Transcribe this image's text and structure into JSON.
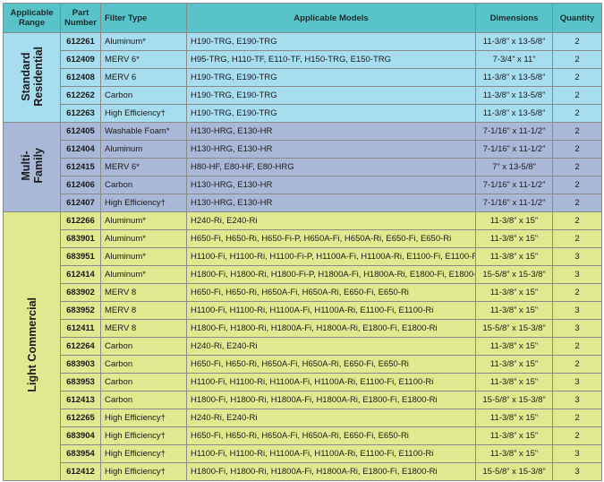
{
  "headers": {
    "range": "Applicable Range",
    "part": "Part Number",
    "filter": "Filter Type",
    "models": "Applicable Models",
    "dimensions": "Dimensions",
    "quantity": "Quantity"
  },
  "colors": {
    "header": "#58c4c9",
    "standard_residential": "#a6def0",
    "multi_family": "#aab8d8",
    "light_commercial": "#dfe98f"
  },
  "groups": [
    {
      "name": "Standard Residential",
      "rows": [
        {
          "part": "612261",
          "filter": "Aluminum*",
          "models": "H190-TRG, E190-TRG",
          "dim": "11-3/8” x 13-5/8”",
          "qty": "2"
        },
        {
          "part": "612409",
          "filter": "MERV 6*",
          "models": "H95-TRG, H110-TF, E110-TF, H150-TRG, E150-TRG",
          "dim": "7-3/4” x 11”",
          "qty": "2"
        },
        {
          "part": "612408",
          "filter": "MERV 6",
          "models": "H190-TRG, E190-TRG",
          "dim": "11-3/8” x 13-5/8”",
          "qty": "2"
        },
        {
          "part": "612262",
          "filter": "Carbon",
          "models": "H190-TRG, E190-TRG",
          "dim": "11-3/8” x 13-5/8”",
          "qty": "2"
        },
        {
          "part": "612263",
          "filter": "High Efficiency†",
          "models": "H190-TRG, E190-TRG",
          "dim": "11-3/8” x 13-5/8”",
          "qty": "2"
        }
      ]
    },
    {
      "name": "Multi-Family",
      "rows": [
        {
          "part": "612405",
          "filter": "Washable Foam*",
          "models": "H130-HRG, E130-HR",
          "dim": "7-1/16” x 11-1/2”",
          "qty": "2"
        },
        {
          "part": "612404",
          "filter": "Aluminum",
          "models": "H130-HRG, E130-HR",
          "dim": "7-1/16” x 11-1/2”",
          "qty": "2"
        },
        {
          "part": "612415",
          "filter": "MERV 6*",
          "models": "H80-HF, E80-HF, E80-HRG",
          "dim": "7” x 13-5/8”",
          "qty": "2"
        },
        {
          "part": "612406",
          "filter": "Carbon",
          "models": "H130-HRG, E130-HR",
          "dim": "7-1/16” x 11-1/2”",
          "qty": "2"
        },
        {
          "part": "612407",
          "filter": "High Efficiency†",
          "models": "H130-HRG, E130-HR",
          "dim": "7-1/16” x 11-1/2”",
          "qty": "2"
        }
      ]
    },
    {
      "name": "Light Commercial",
      "rows": [
        {
          "part": "612266",
          "filter": "Aluminum*",
          "models": "H240-Ri, E240-Ri",
          "dim": "11-3/8” x 15”",
          "qty": "2"
        },
        {
          "part": "683901",
          "filter": "Aluminum*",
          "models": "H650-Fi, H650-Ri, H650-Fi-P, H650A-Fi, H650A-Ri, E650-Fi, E650-Ri",
          "dim": "11-3/8” x 15”",
          "qty": "2"
        },
        {
          "part": "683951",
          "filter": "Aluminum*",
          "models": "H1100-Fi, H1100-Ri, H1100-Fi-P, H1100A-Fi, H1100A-Ri, E1100-Fi, E1100-Ri",
          "dim": "11-3/8” x 15”",
          "qty": "3"
        },
        {
          "part": "612414",
          "filter": "Aluminum*",
          "models": "H1800-Fi, H1800-Ri, H1800-Fi-P, H1800A-Fi, H1800A-Ri, E1800-Fi, E1800-Ri",
          "dim": "15-5/8” x 15-3/8”",
          "qty": "3"
        },
        {
          "part": "683902",
          "filter": "MERV 8",
          "models": "H650-Fi, H650-Ri, H650A-Fi, H650A-Ri, E650-Fi, E650-Ri",
          "dim": "11-3/8” x 15”",
          "qty": "2"
        },
        {
          "part": "683952",
          "filter": "MERV 8",
          "models": "H1100-Fi, H1100-Ri, H1100A-Fi, H1100A-Ri, E1100-Fi, E1100-Ri",
          "dim": "11-3/8” x 15”",
          "qty": "3"
        },
        {
          "part": "612411",
          "filter": "MERV 8",
          "models": "H1800-Fi, H1800-Ri, H1800A-Fi, H1800A-Ri, E1800-Fi, E1800-Ri",
          "dim": "15-5/8” x 15-3/8”",
          "qty": "3"
        },
        {
          "part": "612264",
          "filter": "Carbon",
          "models": "H240-Ri, E240-Ri",
          "dim": "11-3/8” x 15”",
          "qty": "2"
        },
        {
          "part": "683903",
          "filter": "Carbon",
          "models": "H650-Fi, H650-Ri, H650A-Fi, H650A-Ri, E650-Fi, E650-Ri",
          "dim": "11-3/8” x 15”",
          "qty": "2"
        },
        {
          "part": "683953",
          "filter": "Carbon",
          "models": "H1100-Fi, H1100-Ri, H1100A-Fi, H1100A-Ri, E1100-Fi, E1100-Ri",
          "dim": "11-3/8” x 15”",
          "qty": "3"
        },
        {
          "part": "612413",
          "filter": "Carbon",
          "models": "H1800-Fi, H1800-Ri, H1800A-Fi, H1800A-Ri, E1800-Fi, E1800-Ri",
          "dim": "15-5/8” x 15-3/8”",
          "qty": "3"
        },
        {
          "part": "612265",
          "filter": "High Efficiency†",
          "models": "H240-Ri, E240-Ri",
          "dim": "11-3/8” x 15”",
          "qty": "2"
        },
        {
          "part": "683904",
          "filter": "High Efficiency†",
          "models": "H650-Fi, H650-Ri, H650A-Fi, H650A-Ri, E650-Fi, E650-Ri",
          "dim": "11-3/8” x 15”",
          "qty": "2"
        },
        {
          "part": "683954",
          "filter": "High Efficiency†",
          "models": "H1100-Fi, H1100-Ri, H1100A-Fi, H1100A-Ri, E1100-Fi, E1100-Ri",
          "dim": "11-3/8” x 15”",
          "qty": "3"
        },
        {
          "part": "612412",
          "filter": "High Efficiency†",
          "models": "H1800-Fi, H1800-Ri, H1800A-Fi, H1800A-Ri, E1800-Fi, E1800-Ri",
          "dim": "15-5/8” x 15-3/8”",
          "qty": "3"
        }
      ]
    }
  ]
}
